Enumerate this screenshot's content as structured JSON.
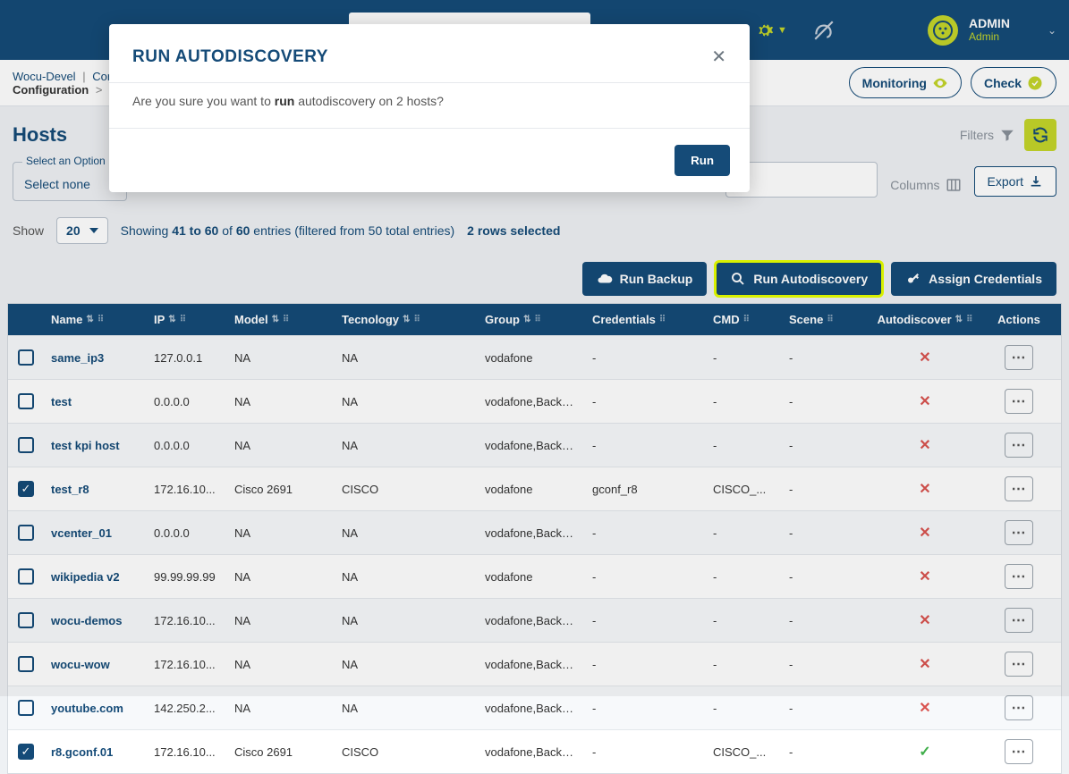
{
  "topbar": {
    "user_name": "ADMIN",
    "user_role": "Admin"
  },
  "breadcrumb": {
    "root": "Wocu-Devel",
    "level1": "Configuration",
    "level2": "Configuration",
    "monitoring_btn": "Monitoring",
    "check_btn": "Check"
  },
  "page": {
    "title": "Hosts",
    "filters_label": "Filters",
    "select_option_label": "Select an Option",
    "select_option_value": "Select none",
    "columns_label": "Columns",
    "export_label": "Export",
    "show_label": "Show",
    "show_value": "20",
    "showing_text_prefix": "Showing ",
    "showing_range": "41 to 60",
    "showing_mid": " of ",
    "showing_total": "60",
    "showing_suffix": " entries (filtered from 50 total entries)",
    "rows_selected": "2 rows selected"
  },
  "actions": {
    "run_backup": "Run Backup",
    "run_autodiscovery": "Run Autodiscovery",
    "assign_credentials": "Assign Credentials"
  },
  "columns": [
    "Name",
    "IP",
    "Model",
    "Tecnology",
    "Group",
    "Credentials",
    "CMD",
    "Scene",
    "Autodiscover",
    "Actions"
  ],
  "rows": [
    {
      "checked": false,
      "name": "same_ip3",
      "ip": "127.0.0.1",
      "model": "NA",
      "tech": "NA",
      "group": "vodafone",
      "cred": "-",
      "cmd": "-",
      "scene": "-",
      "auto": "x"
    },
    {
      "checked": false,
      "name": "test",
      "ip": "0.0.0.0",
      "model": "NA",
      "tech": "NA",
      "group": "vodafone,Backb...",
      "cred": "-",
      "cmd": "-",
      "scene": "-",
      "auto": "x"
    },
    {
      "checked": false,
      "name": "test kpi host",
      "ip": "0.0.0.0",
      "model": "NA",
      "tech": "NA",
      "group": "vodafone,Backb...",
      "cred": "-",
      "cmd": "-",
      "scene": "-",
      "auto": "x"
    },
    {
      "checked": true,
      "name": "test_r8",
      "ip": "172.16.10...",
      "model": "Cisco 2691",
      "tech": "CISCO",
      "group": "vodafone",
      "cred": "gconf_r8",
      "cmd": "CISCO_...",
      "scene": "-",
      "auto": "x"
    },
    {
      "checked": false,
      "name": "vcenter_01",
      "ip": "0.0.0.0",
      "model": "NA",
      "tech": "NA",
      "group": "vodafone,Backb...",
      "cred": "-",
      "cmd": "-",
      "scene": "-",
      "auto": "x"
    },
    {
      "checked": false,
      "name": "wikipedia v2",
      "ip": "99.99.99.99",
      "model": "NA",
      "tech": "NA",
      "group": "vodafone",
      "cred": "-",
      "cmd": "-",
      "scene": "-",
      "auto": "x"
    },
    {
      "checked": false,
      "name": "wocu-demos",
      "ip": "172.16.10...",
      "model": "NA",
      "tech": "NA",
      "group": "vodafone,Backb...",
      "cred": "-",
      "cmd": "-",
      "scene": "-",
      "auto": "x"
    },
    {
      "checked": false,
      "name": "wocu-wow",
      "ip": "172.16.10...",
      "model": "NA",
      "tech": "NA",
      "group": "vodafone,Backb...",
      "cred": "-",
      "cmd": "-",
      "scene": "-",
      "auto": "x"
    },
    {
      "checked": false,
      "name": "youtube.com",
      "ip": "142.250.2...",
      "model": "NA",
      "tech": "NA",
      "group": "vodafone,Backb...",
      "cred": "-",
      "cmd": "-",
      "scene": "-",
      "auto": "x"
    },
    {
      "checked": true,
      "name": "r8.gconf.01",
      "ip": "172.16.10...",
      "model": "Cisco 2691",
      "tech": "CISCO",
      "group": "vodafone,Backb...",
      "cred": "-",
      "cmd": "CISCO_...",
      "scene": "-",
      "auto": "check"
    }
  ],
  "modal": {
    "title": "RUN AUTODISCOVERY",
    "body_prefix": "Are you sure you want to ",
    "body_bold": "run",
    "body_suffix": " autodiscovery on 2 hosts?",
    "run_btn": "Run"
  }
}
